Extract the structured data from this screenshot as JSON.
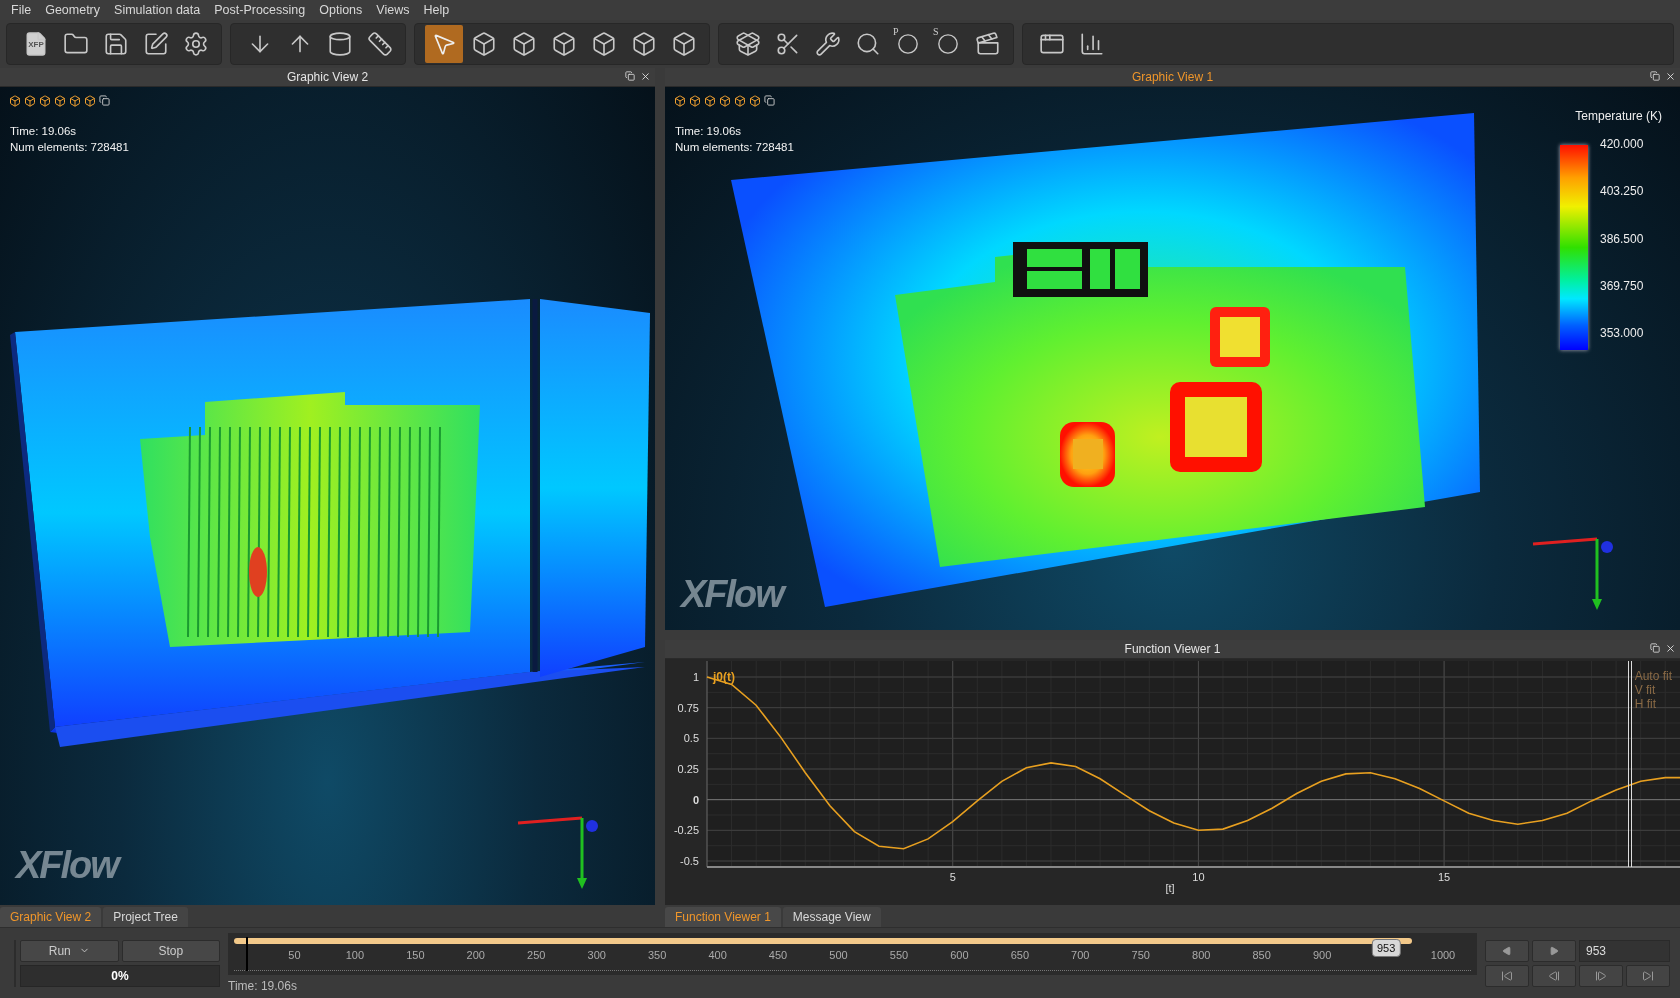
{
  "menu": [
    "File",
    "Geometry",
    "Simulation data",
    "Post-Processing",
    "Options",
    "Views",
    "Help"
  ],
  "toolbar": [
    {
      "buttons": [
        {
          "label": "XFP",
          "selected": false
        },
        {
          "selected": false
        },
        {
          "selected": false
        },
        {
          "selected": false
        },
        {
          "selected": false
        }
      ]
    },
    {
      "buttons": [
        {
          "selected": false
        },
        {
          "selected": false
        },
        {
          "selected": false
        },
        {
          "selected": false
        }
      ]
    },
    {
      "buttons": [
        {
          "selected": true
        },
        {
          "selected": false
        },
        {
          "selected": false
        },
        {
          "selected": false
        },
        {
          "selected": false
        },
        {
          "selected": false
        },
        {
          "selected": false
        }
      ]
    },
    {
      "buttons": [
        {
          "selected": false
        },
        {
          "selected": false
        },
        {
          "selected": false
        },
        {
          "selected": false
        },
        {
          "label": "P",
          "selected": false
        },
        {
          "label": "S",
          "selected": false
        },
        {
          "selected": false
        }
      ]
    },
    {
      "buttons": [
        {
          "selected": false
        },
        {
          "selected": false
        }
      ]
    }
  ],
  "graphic_view_2": {
    "title": "Graphic View 2",
    "active": false,
    "time": "Time: 19.06s",
    "elements": "Num elements: 728481",
    "logo": "XFlow"
  },
  "graphic_view_1": {
    "title": "Graphic View 1",
    "active": true,
    "time": "Time: 19.06s",
    "elements": "Num elements: 728481",
    "logo": "XFlow",
    "legend": {
      "title": "Temperature (K)",
      "ticks": [
        "420.000",
        "403.250",
        "386.500",
        "369.750",
        "353.000"
      ]
    }
  },
  "left_tabs": [
    {
      "label": "Graphic View 2",
      "selected": true
    },
    {
      "label": "Project Tree",
      "selected": false
    }
  ],
  "function_viewer": {
    "title": "Function Viewer 1",
    "active": false,
    "fit_buttons": [
      "Auto fit",
      "V fit",
      "H fit"
    ],
    "chart_data": {
      "type": "line",
      "grid": true,
      "xlabel": "[t]",
      "xlim": [
        0,
        19.8
      ],
      "ylim": [
        -0.5,
        1
      ],
      "xticks": [
        5,
        10,
        15
      ],
      "yticks": [
        {
          "value": 1,
          "label": "1"
        },
        {
          "value": 0.75,
          "label": "0.75"
        },
        {
          "value": 0.5,
          "label": "0.5"
        },
        {
          "value": 0.25,
          "label": "0.25"
        },
        {
          "value": 0,
          "label": "0"
        },
        {
          "value": -0.25,
          "label": "-0.25"
        },
        {
          "value": -0.5,
          "label": "-0.5"
        }
      ],
      "x": [
        0,
        0.5,
        1,
        1.5,
        2,
        2.5,
        3,
        3.5,
        4,
        4.5,
        5,
        5.5,
        6,
        6.5,
        7,
        7.5,
        8,
        8.5,
        9,
        9.5,
        10,
        10.5,
        11,
        11.5,
        12,
        12.5,
        13,
        13.5,
        14,
        14.5,
        15,
        15.5,
        16,
        16.5,
        17,
        17.5,
        18,
        18.5,
        19,
        19.5,
        19.8
      ],
      "series": [
        {
          "name": "j0(t)",
          "color": "#e8a020",
          "values": [
            1,
            0.94,
            0.77,
            0.51,
            0.22,
            -0.05,
            -0.26,
            -0.38,
            -0.4,
            -0.32,
            -0.18,
            -0.01,
            0.15,
            0.26,
            0.3,
            0.27,
            0.17,
            0.04,
            -0.09,
            -0.19,
            -0.25,
            -0.24,
            -0.17,
            -0.07,
            0.05,
            0.15,
            0.21,
            0.22,
            0.17,
            0.09,
            -0.01,
            -0.11,
            -0.17,
            -0.2,
            -0.17,
            -0.11,
            -0.01,
            0.08,
            0.15,
            0.18,
            0.18
          ]
        }
      ]
    }
  },
  "right_tabs": [
    {
      "label": "Function Viewer 1",
      "selected": true
    },
    {
      "label": "Message View",
      "selected": false
    }
  ],
  "controls": {
    "run": "Run",
    "stop": "Stop",
    "progress": {
      "label": "0%",
      "level": 0
    },
    "timeline": {
      "ticks": [
        "50",
        "100",
        "150",
        "200",
        "250",
        "300",
        "350",
        "400",
        "450",
        "500",
        "550",
        "600",
        "650",
        "700",
        "750",
        "800",
        "850",
        "900",
        "1000"
      ],
      "level": 0.953,
      "thumb": "953"
    },
    "time": "Time: 19.06s",
    "frame": "953"
  }
}
